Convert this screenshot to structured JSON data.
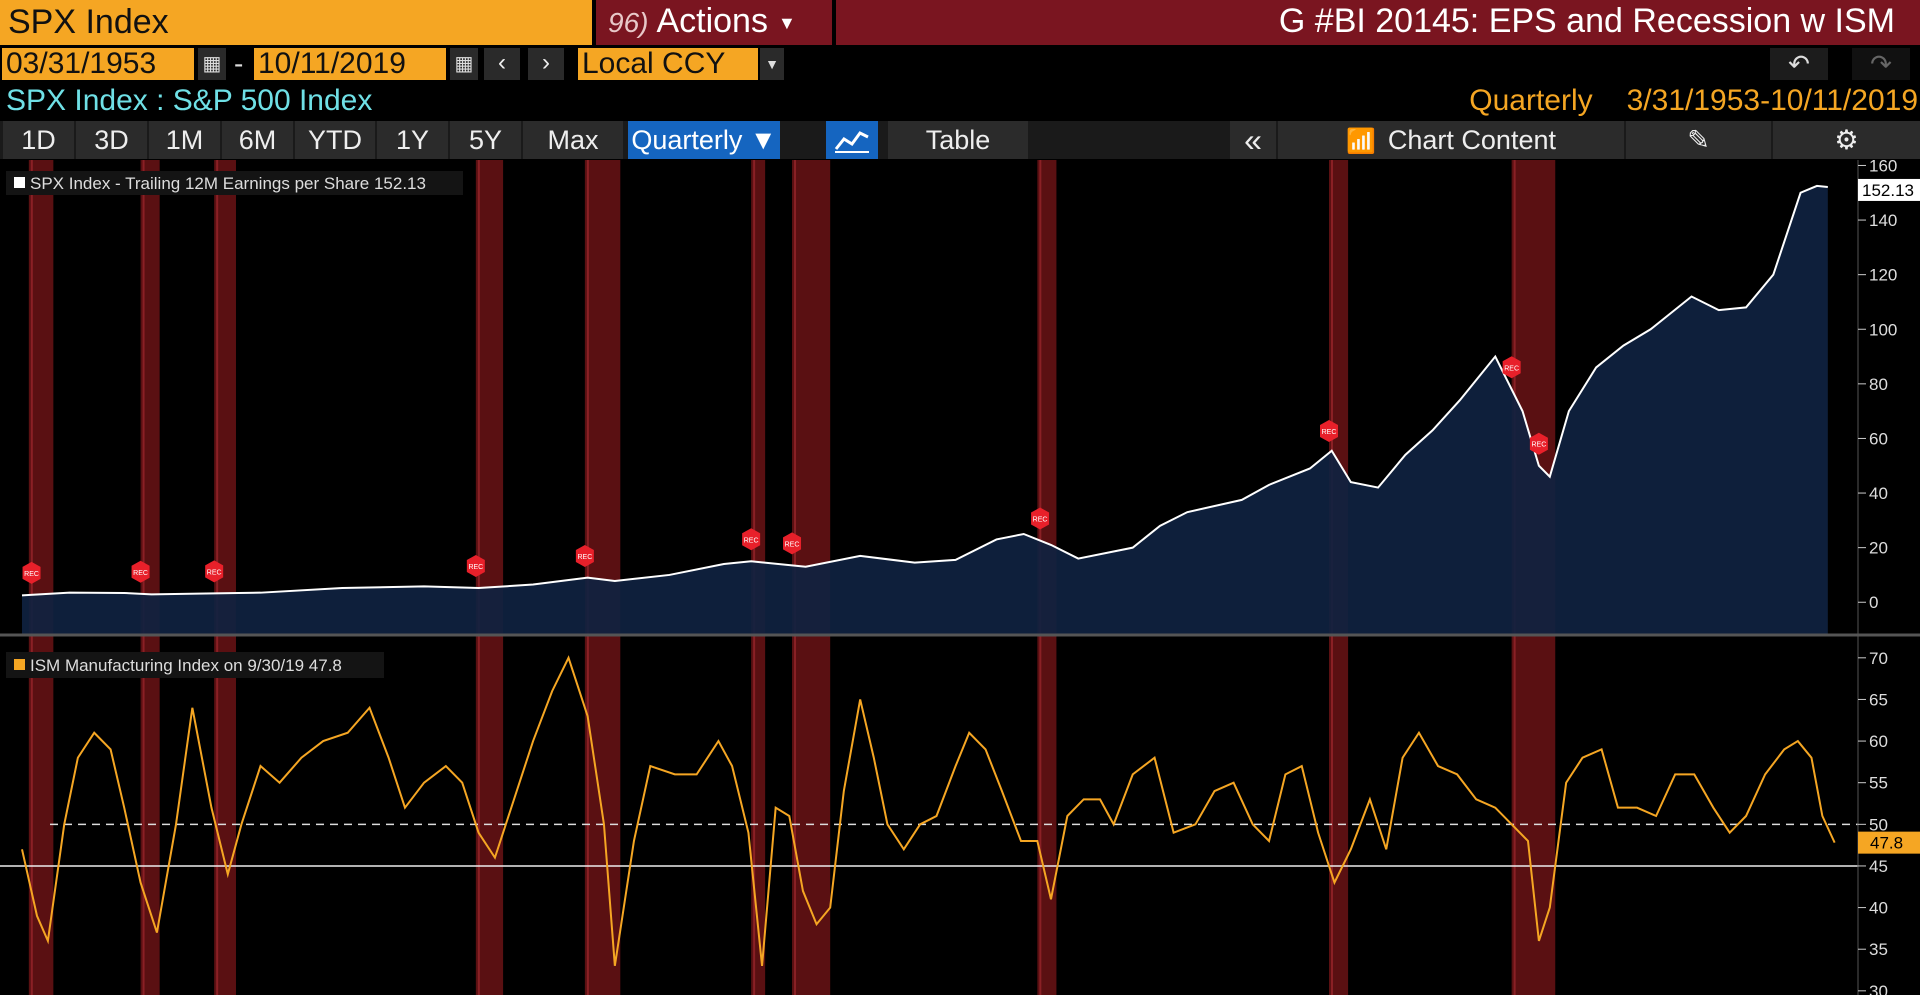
{
  "header": {
    "ticker": "SPX Index",
    "actions_num": "96)",
    "actions_label": "Actions",
    "title": "G #BI 20145: EPS and Recession w ISM"
  },
  "controls": {
    "start_date": "03/31/1953",
    "date_sep": "-",
    "end_date": "10/11/2019",
    "currency": "Local CCY"
  },
  "security_line": "SPX Index : S&P 500 Index",
  "period_line": {
    "frequency": "Quarterly",
    "range": "3/31/1953-10/11/2019"
  },
  "toolbar": {
    "ranges": [
      "1D",
      "3D",
      "1M",
      "6M",
      "YTD",
      "1Y",
      "5Y",
      "Max"
    ],
    "frequency": "Quarterly ▼",
    "table_label": "Table",
    "collapse_label": "«",
    "chart_content_label": "Chart Content"
  },
  "colors": {
    "accent": "#f5a623",
    "title_bar": "#7a1520",
    "eps_line": "#ffffff",
    "eps_area": "#0f2240",
    "ism_line": "#f5a623",
    "recession_band": "#5a1012",
    "rec_marker": "#e8202a"
  },
  "chart_data": [
    {
      "type": "area",
      "legend": "SPX Index - Trailing 12M Earnings per Share 152.13",
      "last_value_label": "152.13",
      "y_ticks": [
        "160",
        "140",
        "120",
        "100",
        "80",
        "60",
        "40",
        "20",
        "0"
      ],
      "ylim": [
        -12,
        162
      ],
      "xlim": [
        1953.25,
        2019.8
      ],
      "series": [
        {
          "name": "SPX Index - Trailing 12M Earnings per Share",
          "points": [
            [
              1953.25,
              2.5
            ],
            [
              1955,
              3.5
            ],
            [
              1957,
              3.4
            ],
            [
              1958,
              2.9
            ],
            [
              1960,
              3.2
            ],
            [
              1962,
              3.5
            ],
            [
              1965,
              5.2
            ],
            [
              1968,
              5.8
            ],
            [
              1970,
              5.2
            ],
            [
              1972,
              6.5
            ],
            [
              1974,
              9.0
            ],
            [
              1975,
              7.8
            ],
            [
              1977,
              10.0
            ],
            [
              1979,
              14.0
            ],
            [
              1980,
              15.0
            ],
            [
              1982,
              13.0
            ],
            [
              1984,
              17.0
            ],
            [
              1986,
              14.5
            ],
            [
              1987.5,
              15.5
            ],
            [
              1989,
              23.0
            ],
            [
              1990,
              25.0
            ],
            [
              1991,
              21.0
            ],
            [
              1992,
              16.0
            ],
            [
              1994,
              20.0
            ],
            [
              1995,
              28.0
            ],
            [
              1996,
              33.0
            ],
            [
              1998,
              37.5
            ],
            [
              1999,
              43.0
            ],
            [
              2000.5,
              49.0
            ],
            [
              2001.3,
              55.5
            ],
            [
              2002,
              44.0
            ],
            [
              2003,
              42.0
            ],
            [
              2004,
              54.0
            ],
            [
              2005,
              63.0
            ],
            [
              2006,
              74.0
            ],
            [
              2007.3,
              90.0
            ],
            [
              2008.3,
              70.0
            ],
            [
              2008.9,
              50.0
            ],
            [
              2009.3,
              46.0
            ],
            [
              2010,
              70.0
            ],
            [
              2011,
              86.0
            ],
            [
              2012,
              94.0
            ],
            [
              2013,
              100.0
            ],
            [
              2014.5,
              112.0
            ],
            [
              2015.5,
              107.0
            ],
            [
              2016.5,
              108.0
            ],
            [
              2017.5,
              120.0
            ],
            [
              2018.5,
              150.0
            ],
            [
              2019.1,
              152.5
            ],
            [
              2019.5,
              152.13
            ]
          ]
        }
      ],
      "recession_markers": [
        1953.6,
        1957.6,
        1960.3,
        1969.9,
        1973.9,
        1980.0,
        1981.5,
        1990.6,
        2001.2,
        2007.9,
        2008.9
      ]
    },
    {
      "type": "line",
      "legend": "ISM Manufacturing Index on 9/30/19 47.8",
      "last_value_label": "47.8",
      "reference_lines": [
        50,
        45
      ],
      "y_ticks": [
        "70",
        "65",
        "60",
        "55",
        "50",
        "45",
        "40",
        "35",
        "30"
      ],
      "ylim": [
        29.5,
        72.5
      ],
      "xlim": [
        1953.25,
        2019.8
      ],
      "series": [
        {
          "name": "ISM Manufacturing Index",
          "points": [
            [
              1953.25,
              47
            ],
            [
              1953.8,
              39
            ],
            [
              1954.2,
              36
            ],
            [
              1954.8,
              50
            ],
            [
              1955.3,
              58
            ],
            [
              1955.9,
              61
            ],
            [
              1956.5,
              59
            ],
            [
              1957.0,
              52
            ],
            [
              1957.6,
              43
            ],
            [
              1958.2,
              37
            ],
            [
              1958.9,
              50
            ],
            [
              1959.5,
              64
            ],
            [
              1960.2,
              52
            ],
            [
              1960.8,
              44
            ],
            [
              1961.3,
              50
            ],
            [
              1962.0,
              57
            ],
            [
              1962.7,
              55
            ],
            [
              1963.5,
              58
            ],
            [
              1964.3,
              60
            ],
            [
              1965.2,
              61
            ],
            [
              1966.0,
              64
            ],
            [
              1966.7,
              58
            ],
            [
              1967.3,
              52
            ],
            [
              1968.0,
              55
            ],
            [
              1968.8,
              57
            ],
            [
              1969.4,
              55
            ],
            [
              1970.0,
              49
            ],
            [
              1970.6,
              46
            ],
            [
              1971.2,
              52
            ],
            [
              1972.0,
              60
            ],
            [
              1972.7,
              66
            ],
            [
              1973.3,
              70
            ],
            [
              1974.0,
              63
            ],
            [
              1974.6,
              50
            ],
            [
              1975.0,
              33
            ],
            [
              1975.7,
              48
            ],
            [
              1976.3,
              57
            ],
            [
              1977.2,
              56
            ],
            [
              1978.0,
              56
            ],
            [
              1978.8,
              60
            ],
            [
              1979.3,
              57
            ],
            [
              1979.9,
              49
            ],
            [
              1980.4,
              33
            ],
            [
              1980.9,
              52
            ],
            [
              1981.4,
              51
            ],
            [
              1981.9,
              42
            ],
            [
              1982.4,
              38
            ],
            [
              1982.9,
              40
            ],
            [
              1983.4,
              54
            ],
            [
              1984.0,
              65
            ],
            [
              1984.5,
              58
            ],
            [
              1985.0,
              50
            ],
            [
              1985.6,
              47
            ],
            [
              1986.2,
              50
            ],
            [
              1986.8,
              51
            ],
            [
              1987.5,
              57
            ],
            [
              1988.0,
              61
            ],
            [
              1988.6,
              59
            ],
            [
              1989.2,
              54
            ],
            [
              1989.9,
              48
            ],
            [
              1990.5,
              48
            ],
            [
              1991.0,
              41
            ],
            [
              1991.6,
              51
            ],
            [
              1992.2,
              53
            ],
            [
              1992.8,
              53
            ],
            [
              1993.3,
              50
            ],
            [
              1994.0,
              56
            ],
            [
              1994.8,
              58
            ],
            [
              1995.5,
              49
            ],
            [
              1996.3,
              50
            ],
            [
              1997.0,
              54
            ],
            [
              1997.7,
              55
            ],
            [
              1998.4,
              50
            ],
            [
              1999.0,
              48
            ],
            [
              1999.6,
              56
            ],
            [
              2000.2,
              57
            ],
            [
              2000.8,
              49
            ],
            [
              2001.4,
              43
            ],
            [
              2002.0,
              47
            ],
            [
              2002.7,
              53
            ],
            [
              2003.3,
              47
            ],
            [
              2003.9,
              58
            ],
            [
              2004.5,
              61
            ],
            [
              2005.2,
              57
            ],
            [
              2005.9,
              56
            ],
            [
              2006.6,
              53
            ],
            [
              2007.3,
              52
            ],
            [
              2007.9,
              50
            ],
            [
              2008.5,
              48
            ],
            [
              2008.9,
              36
            ],
            [
              2009.3,
              40
            ],
            [
              2009.9,
              55
            ],
            [
              2010.5,
              58
            ],
            [
              2011.2,
              59
            ],
            [
              2011.8,
              52
            ],
            [
              2012.5,
              52
            ],
            [
              2013.2,
              51
            ],
            [
              2013.9,
              56
            ],
            [
              2014.6,
              56
            ],
            [
              2015.3,
              52
            ],
            [
              2015.9,
              49
            ],
            [
              2016.5,
              51
            ],
            [
              2017.2,
              56
            ],
            [
              2017.9,
              59
            ],
            [
              2018.4,
              60
            ],
            [
              2018.9,
              58
            ],
            [
              2019.3,
              51
            ],
            [
              2019.75,
              47.8
            ]
          ]
        }
      ]
    }
  ],
  "recessions": [
    [
      1953.5,
      1954.4
    ],
    [
      1957.6,
      1958.3
    ],
    [
      1960.3,
      1961.1
    ],
    [
      1969.9,
      1970.9
    ],
    [
      1973.9,
      1975.2
    ],
    [
      1980.0,
      1980.5
    ],
    [
      1981.5,
      1982.9
    ],
    [
      1990.5,
      1991.2
    ],
    [
      2001.2,
      2001.9
    ],
    [
      2007.9,
      2009.5
    ]
  ]
}
